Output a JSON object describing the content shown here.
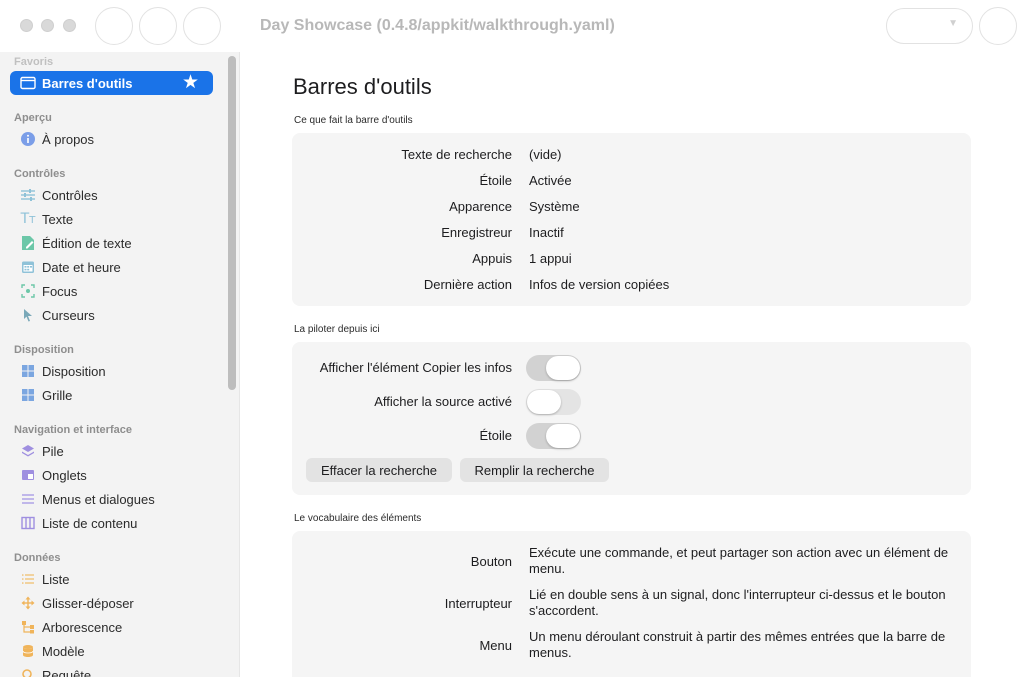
{
  "window": {
    "title": "Day Showcase (0.4.8/appkit/walkthrough.yaml)",
    "accent": "#1a73e8"
  },
  "sidebar": {
    "sections": {
      "favoris": "Favoris",
      "apercu": "Aperçu",
      "controles": "Contrôles",
      "disposition": "Disposition",
      "navigation": "Navigation et interface",
      "donnees": "Données"
    },
    "items": {
      "barres": "Barres d'outils",
      "apropos": "À propos",
      "controles": "Contrôles",
      "texte": "Texte",
      "edition": "Édition de texte",
      "date": "Date et heure",
      "focus": "Focus",
      "curseurs": "Curseurs",
      "disposition": "Disposition",
      "grille": "Grille",
      "pile": "Pile",
      "onglets": "Onglets",
      "menus": "Menus et dialogues",
      "liste_contenu": "Liste de contenu",
      "liste": "Liste",
      "glisser": "Glisser-déposer",
      "arborescence": "Arborescence",
      "modele": "Modèle",
      "requete": "Requête"
    },
    "selected": "barres"
  },
  "main": {
    "title": "Barres d'outils",
    "section1": {
      "heading": "Ce que fait la barre d'outils",
      "rows": [
        {
          "key": "Texte de recherche",
          "value": "(vide)"
        },
        {
          "key": "Étoile",
          "value": "Activée"
        },
        {
          "key": "Apparence",
          "value": "Système"
        },
        {
          "key": "Enregistreur",
          "value": "Inactif"
        },
        {
          "key": "Appuis",
          "value": "1 appui"
        },
        {
          "key": "Dernière action",
          "value": "Infos de version copiées"
        }
      ]
    },
    "section2": {
      "heading": "La piloter depuis ici",
      "toggles": [
        {
          "label": "Afficher l'élément Copier les infos",
          "on": true
        },
        {
          "label": "Afficher la source activé",
          "on": false
        },
        {
          "label": "Étoile",
          "on": true
        }
      ],
      "buttons": {
        "clear": "Effacer la recherche",
        "fill": "Remplir la recherche"
      }
    },
    "section3": {
      "heading": "Le vocabulaire des éléments",
      "rows": [
        {
          "key": "Bouton",
          "desc": "Exécute une commande, et peut partager son action avec un élément de menu."
        },
        {
          "key": "Interrupteur",
          "desc": "Lié en double sens à un signal, donc l'interrupteur ci-dessus et le bouton s'accordent."
        },
        {
          "key": "Menu",
          "desc": "Un menu déroulant construit à partir des mêmes entrées que la barre de menus."
        }
      ]
    }
  }
}
